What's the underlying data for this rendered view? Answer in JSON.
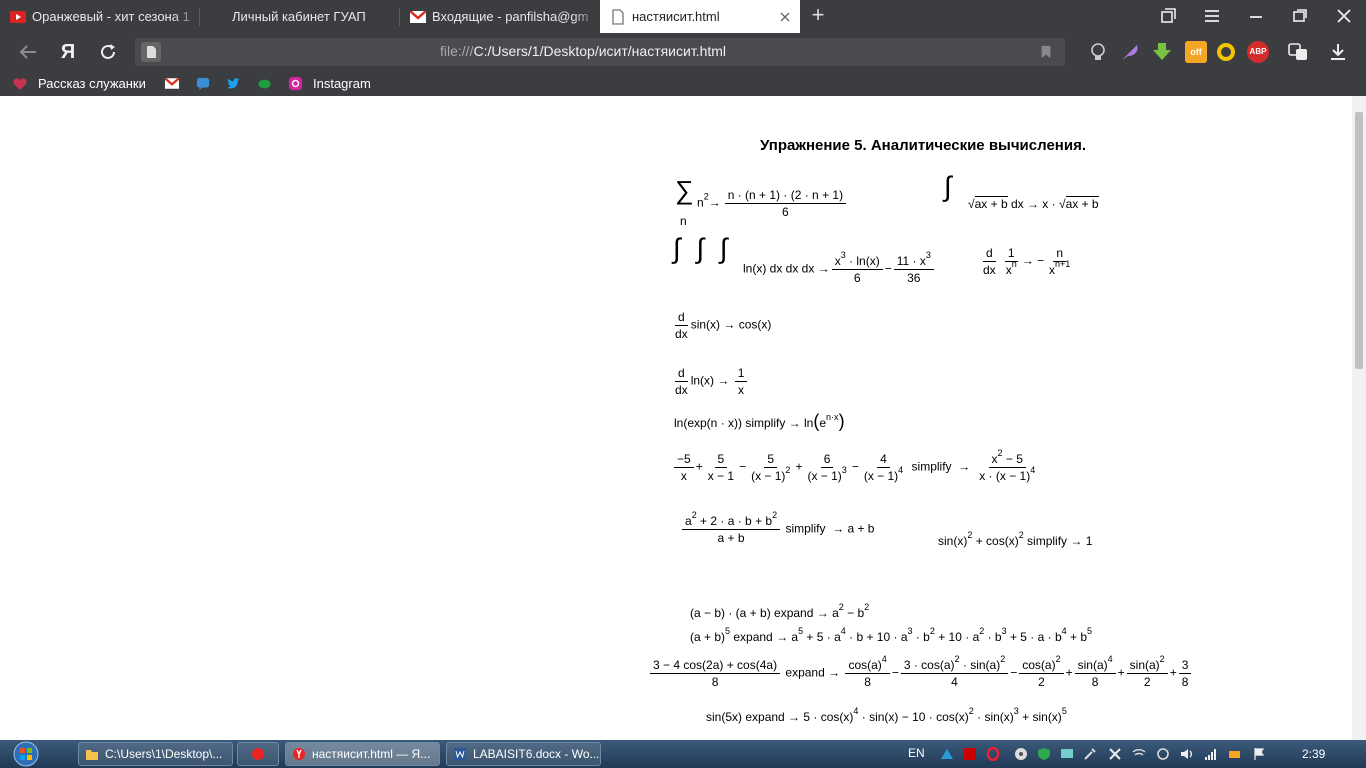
{
  "browser": {
    "tabs": [
      {
        "title": "Оранжевый - хит сезона 1",
        "active": false
      },
      {
        "title": "Личный кабинет ГУАП",
        "active": false
      },
      {
        "title": "Входящие - panfilsha@gm",
        "active": false
      },
      {
        "title": "настяисит.html",
        "active": true
      }
    ],
    "url_scheme": "file:///",
    "url_path": "C:/Users/1/Desktop/исит/настяисит.html",
    "yandex_letter": "Я",
    "bookmarks": [
      {
        "label": "Рассказ служанки"
      },
      {
        "label": ""
      },
      {
        "label": ""
      },
      {
        "label": ""
      },
      {
        "label": ""
      },
      {
        "label": "Instagram"
      }
    ],
    "extension_abp": "ABP",
    "extension_off": "off"
  },
  "page": {
    "title": "Упражнение 5. Аналитические вычисления.",
    "expr": {
      "sum_sym": "∑",
      "sum_sub": "n",
      "sum_body": "n",
      "p2": "2",
      "arrow": "→",
      "sum_num": "n · (n + 1) · (2 · n + 1)",
      "sum_den": "6",
      "int_sym": "∫",
      "sqrt_sym": "√",
      "sqrt_arg": "ax + b",
      "int1_dx": "dx → x ·",
      "triple": "∫ ∫ ∫",
      "triple_body": "ln(x) dx dx dx →",
      "t_num_a": "x",
      "p3": "3",
      "t_num_b": " · ln(x)",
      "t_den": "6",
      "minus": "−",
      "t2_num_a": "11 · x",
      "t2_den": "36",
      "d": "d",
      "dx": "dx",
      "one": "1",
      "xn_a": "x",
      "n_sup": "n",
      "arrow_neg": "→ −",
      "n": "n",
      "xn1_sup": "n+1",
      "sin_deriv": "sin(x) → cos(x)",
      "ln_deriv": "ln(x) →",
      "x": "x",
      "lnexp_left": "ln(exp(n · x)) simplify  → ln",
      "lnexp_e": "e",
      "lnexp_sup": "n·x",
      "pf_n1": "−5",
      "pf_d1": "x",
      "plus": "+",
      "pf_n2": "5",
      "pf_d2": "x − 1",
      "pf_n3": "5",
      "pf_d3": "(x − 1)",
      "pf_n4": "6",
      "pf_d4": "(x − 1)",
      "pf_n5": "4",
      "pf_d5": "(x − 1)",
      "p4": "4",
      "simplify": "simplify",
      "pf_rn": "x",
      "pf_rn_b": " − 5",
      "pf_rd": "x · (x − 1)",
      "ab_num": "a",
      "ab_num_b": " + 2 · a · b + b",
      "ab_den": "a + b",
      "ab_res": "→ a + b",
      "trig_a": "sin(x)",
      "trig_b": " + cos(x)",
      "trig_c": " simplify  → 1",
      "exp1_a": "(a − b) · (a + b)  expand   → a",
      "exp1_b": " − b",
      "exp2_a": "(a + b)",
      "p5": "5",
      "exp2_b": "  expand   → a",
      "exp2_c": " + 5 · a",
      "exp2_d": " · b + 10 · a",
      "exp2_e": " · b",
      "exp2_f": " + 10 · a",
      "exp2_g": " + 5 · a · b",
      "exp2_h": " + b",
      "c_num": "3 − 4 cos(2a) + cos(4a)",
      "c_den": "8",
      "expand_arrow": "expand   →",
      "c1_num": "cos(a)",
      "c1_den": "8",
      "c2_num": "3 · cos(a)",
      "c2_num_b": " · sin(a)",
      "c2_den": "4",
      "c3_num": "cos(a)",
      "c3_den": "2",
      "c4_num": "sin(a)",
      "c4_den": "8",
      "c5_num": "sin(a)",
      "c5_den": "2",
      "c6_num": "3",
      "c6_den": "8",
      "s5_a": "sin(5x)  expand   → 5 · cos(x)",
      "s5_b": " · sin(x) − 10 · cos(x)",
      "s5_c": " · sin(x)",
      "s5_d": " + sin(x)"
    }
  },
  "taskbar": {
    "items": [
      {
        "label": "C:\\Users\\1\\Desktop\\...",
        "active": false
      },
      {
        "label": "",
        "active": false
      },
      {
        "label": "настяисит.html — Я...",
        "active": true
      },
      {
        "label": "LABAISIT6.docx - Wo...",
        "active": false
      }
    ],
    "lang": "EN",
    "clock": "2:39"
  },
  "colors": {
    "chrome": "#3c3d41",
    "url_field": "#4a4b50",
    "taskbar": "#2a4766",
    "abp": "#d42b2b",
    "download": "#7bc142"
  }
}
